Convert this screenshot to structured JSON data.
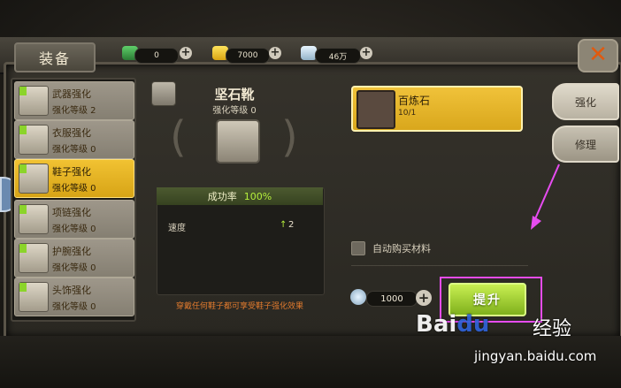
{
  "header": {
    "title": "装备"
  },
  "currencies": [
    {
      "name": "emerald",
      "value": "0"
    },
    {
      "name": "gold",
      "value": "7000"
    },
    {
      "name": "crystal",
      "value": "46万"
    }
  ],
  "slots": [
    {
      "name": "武器强化",
      "level": "强化等级 2"
    },
    {
      "name": "衣服强化",
      "level": "强化等级 0"
    },
    {
      "name": "鞋子强化",
      "level": "强化等级 0"
    },
    {
      "name": "项链强化",
      "level": "强化等级 0"
    },
    {
      "name": "护腕强化",
      "level": "强化等级 0"
    },
    {
      "name": "头饰强化",
      "level": "强化等级 0"
    }
  ],
  "item": {
    "name": "坚石靴",
    "level": "强化等级 0",
    "success_label": "成功率",
    "success_value": "100%",
    "stat_name": "速度",
    "stat_up": "↑",
    "stat_value": "2",
    "hint": "穿戴任何鞋子都可享受鞋子强化效果"
  },
  "material": {
    "name": "百炼石",
    "count": "10/1"
  },
  "tabs": {
    "enhance": "强化",
    "repair": "修理"
  },
  "auto_buy_label": "自动购买材料",
  "cost": {
    "value": "1000"
  },
  "upgrade_label": "提升",
  "watermark": {
    "logo_a": "Bai",
    "logo_b": "du",
    "cn": "经验",
    "url": "jingyan.baidu.com"
  },
  "colors": {
    "accent": "#f0c23a",
    "highlight": "#e64cf0",
    "success": "#b6f03c"
  }
}
